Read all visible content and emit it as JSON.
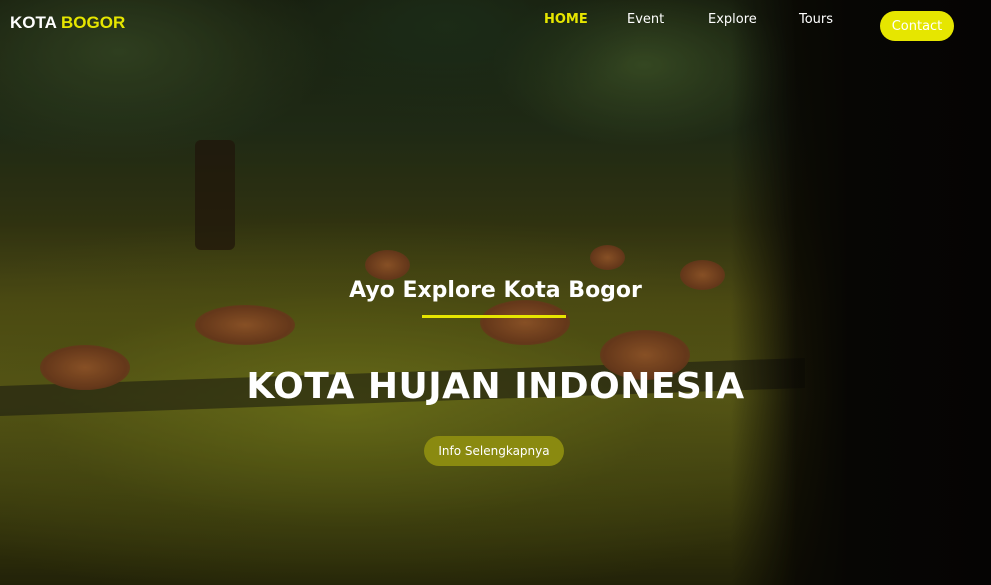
{
  "brand": {
    "part1": "KOTA",
    "part2": "BOGOR",
    "accent_color": "#e6e600"
  },
  "nav": {
    "items": [
      {
        "label": "HOME",
        "active": true
      },
      {
        "label": "Event",
        "active": false
      },
      {
        "label": "Explore",
        "active": false
      },
      {
        "label": "Tours",
        "active": false
      }
    ],
    "contact_label": "Contact"
  },
  "hero": {
    "subtitle": "Ayo Explore Kota Bogor",
    "headline": "KOTA HUJAN INDONESIA",
    "cta_label": "Info Selengkapnya",
    "cta_color": "#8a8a10"
  }
}
